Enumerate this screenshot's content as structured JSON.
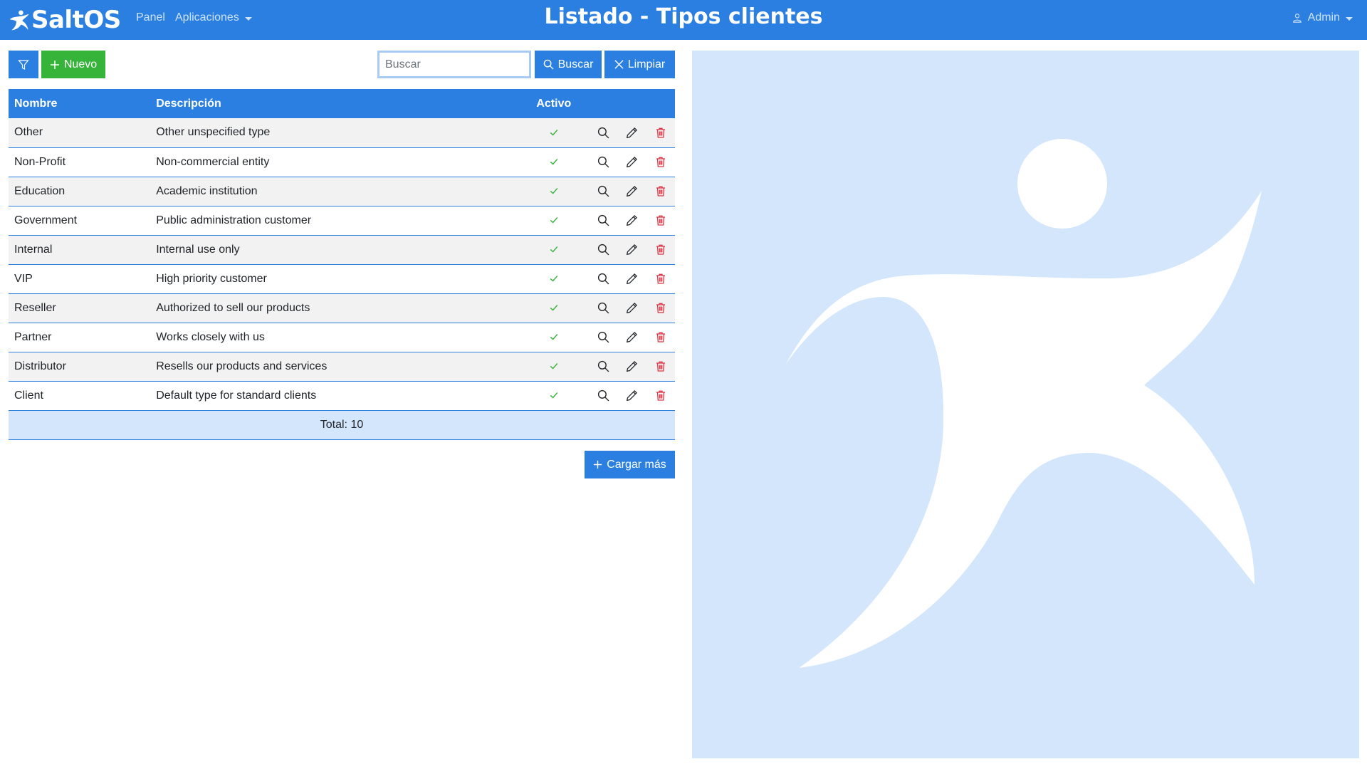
{
  "brand": "SaltOS",
  "nav": {
    "panel": "Panel",
    "apps": "Aplicaciones"
  },
  "title": "Listado - Tipos clientes",
  "user": "Admin",
  "toolbar": {
    "filter_icon": "filter-icon",
    "new_label": "Nuevo",
    "search_placeholder": "Buscar",
    "search_label": "Buscar",
    "clear_label": "Limpiar"
  },
  "table": {
    "headers": {
      "name": "Nombre",
      "description": "Descripción",
      "active": "Activo"
    },
    "rows": [
      {
        "name": "Other",
        "description": "Other unspecified type",
        "active": true
      },
      {
        "name": "Non-Profit",
        "description": "Non-commercial entity",
        "active": true
      },
      {
        "name": "Education",
        "description": "Academic institution",
        "active": true
      },
      {
        "name": "Government",
        "description": "Public administration customer",
        "active": true
      },
      {
        "name": "Internal",
        "description": "Internal use only",
        "active": true
      },
      {
        "name": "VIP",
        "description": "High priority customer",
        "active": true
      },
      {
        "name": "Reseller",
        "description": "Authorized to sell our products",
        "active": true
      },
      {
        "name": "Partner",
        "description": "Works closely with us",
        "active": true
      },
      {
        "name": "Distributor",
        "description": "Resells our products and services",
        "active": true
      },
      {
        "name": "Client",
        "description": "Default type for standard clients",
        "active": true
      }
    ],
    "total": "Total: 10"
  },
  "load_more": "Cargar más",
  "colors": {
    "primary": "#2a7fe0",
    "success": "#36b43a",
    "danger": "#dc3545",
    "panel": "#d3e6fb"
  }
}
